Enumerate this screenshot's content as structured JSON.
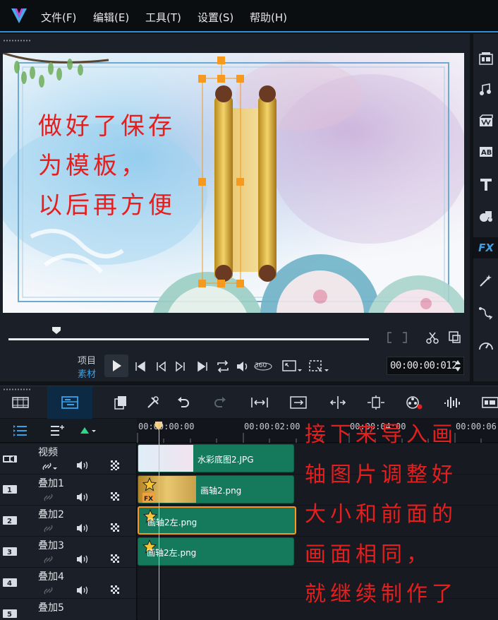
{
  "menu": {
    "items": [
      "文件(F)",
      "编辑(E)",
      "工具(T)",
      "设置(S)",
      "帮助(H)"
    ]
  },
  "preview": {
    "annotation_lines": [
      "做好了保存",
      "为模板，",
      "以后再方便"
    ],
    "label_project": "项目",
    "label_clip": "素材",
    "timecode": "00:00:00:012"
  },
  "right_toolbar": {
    "icons": [
      "media-icon",
      "audio-icon",
      "instant-project-icon",
      "transition-icon",
      "title-icon",
      "graphics-icon",
      "fx-icon",
      "path-icon",
      "motion-icon",
      "speed-icon"
    ],
    "fx_label": "FX"
  },
  "timeline": {
    "ruler": [
      "00:00:00:00",
      "00:00:02:00",
      "00:00:04:00",
      "00:00:06:0"
    ],
    "tracks": [
      {
        "name": "视频",
        "number": "",
        "clips": [
          {
            "label": "水彩底图2.JPG"
          }
        ]
      },
      {
        "name": "叠加1",
        "number": "1",
        "clips": [
          {
            "label": "画轴2.png"
          }
        ]
      },
      {
        "name": "叠加2",
        "number": "2",
        "clips": [
          {
            "label": "画轴2左.png"
          }
        ]
      },
      {
        "name": "叠加3",
        "number": "3",
        "clips": [
          {
            "label": "画轴2左.png"
          }
        ]
      },
      {
        "name": "叠加4",
        "number": "4",
        "clips": []
      },
      {
        "name": "叠加5",
        "number": "5",
        "clips": []
      }
    ],
    "annotation_lines": [
      "接下来导入画",
      "轴图片调整好",
      "大小和前面的",
      "画面相同，",
      "就继续制作了"
    ]
  },
  "colors": {
    "accent": "#2f8fd6",
    "clip": "#157a5b",
    "annotation": "#e51e1e",
    "selection": "#f59a1e"
  }
}
